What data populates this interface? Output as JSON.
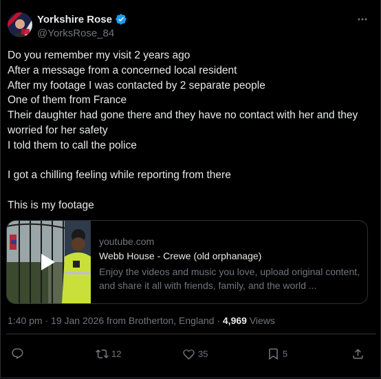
{
  "author": {
    "display_name": "Yorkshire Rose",
    "handle": "@YorksRose_84"
  },
  "tweet": {
    "text": "Do you remember my visit 2 years ago\nAfter a message from a concerned local resident\nAfter my footage I was contacted by 2 separate people\nOne of them from France\nTheir daughter had gone there and they have no contact with her and they worried for her safety\nI told them to call the police\n\nI got a chilling feeling while reporting from there\n\nThis is my footage"
  },
  "card": {
    "domain": "youtube.com",
    "title": "Webb House - Crewe (old orphanage)",
    "description": "Enjoy the videos and music you love, upload original content, and share it all with friends, family, and the world ..."
  },
  "meta": {
    "time": "1:40 pm",
    "date": "19 Jan 2026",
    "location_prefix": "from",
    "location": "Brotherton, England",
    "views_count": "4,969",
    "views_label": "Views"
  },
  "actions": {
    "retweets": "12",
    "likes": "35",
    "bookmarks": "5"
  },
  "colors": {
    "background": "#000000",
    "text": "#e7e9ea",
    "muted": "#71767b",
    "verified": "#1d9bf0",
    "border": "#2f3336"
  }
}
